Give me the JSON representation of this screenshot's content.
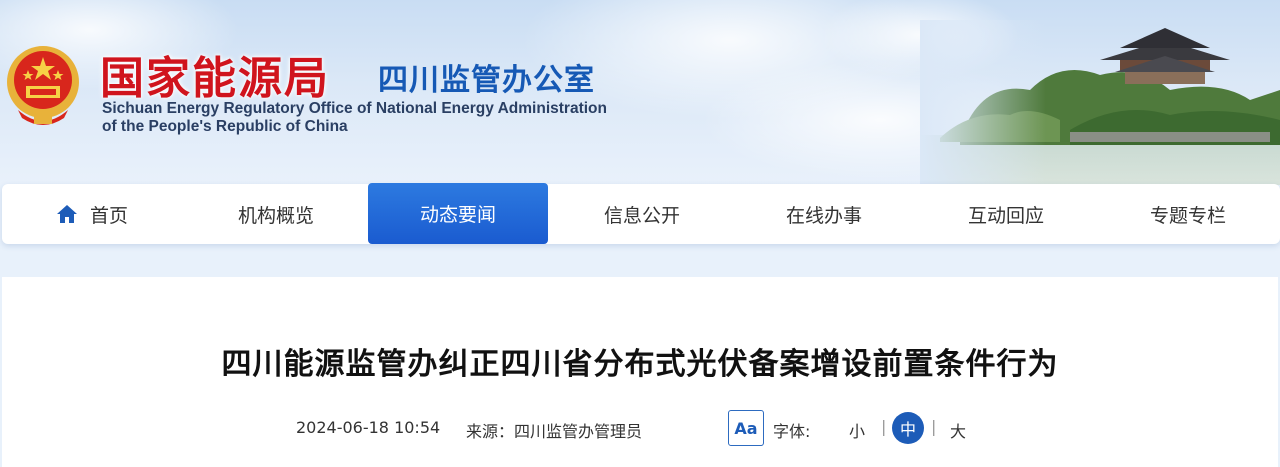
{
  "header": {
    "agency_cn": "国家能源局",
    "office_cn": "四川监管办公室",
    "office_en_line1": "Sichuan Energy Regulatory Office of National Energy Administration",
    "office_en_line2": "of the People's Republic of China"
  },
  "nav": {
    "items": [
      {
        "label": "首页",
        "icon": "home-icon"
      },
      {
        "label": "机构概览"
      },
      {
        "label": "动态要闻",
        "active": true
      },
      {
        "label": "信息公开"
      },
      {
        "label": "在线办事"
      },
      {
        "label": "互动回应"
      },
      {
        "label": "专题专栏"
      }
    ]
  },
  "article": {
    "title": "四川能源监管办纠正四川省分布式光伏备案增设前置条件行为",
    "date": "2024-06-18 10:54",
    "source": "来源：四川监管办管理员",
    "font_size_button": "Aa",
    "font_size_label": "字体:",
    "font_small": "小",
    "font_medium": "中",
    "font_large": "大",
    "separator": "|"
  },
  "colors": {
    "brand_red": "#d0141d",
    "brand_blue": "#1659b5",
    "nav_active": "#1a5bd0"
  }
}
